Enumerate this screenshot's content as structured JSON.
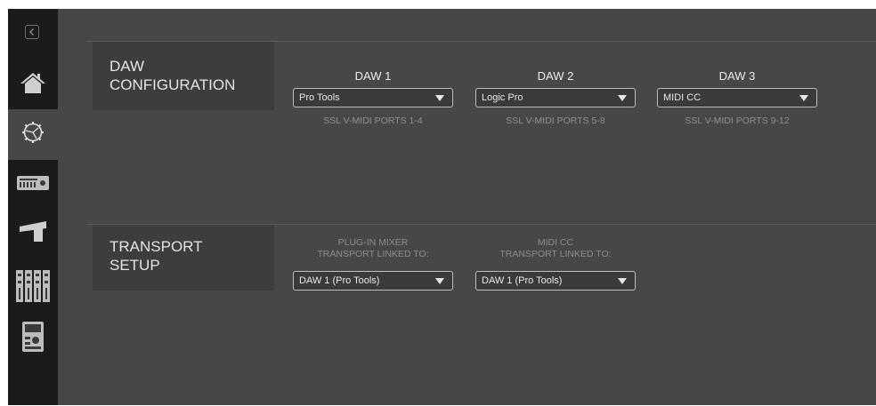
{
  "sidebar": {
    "icons": [
      "collapse-arrow-icon",
      "home-icon",
      "settings-gear-icon",
      "console-module-icon",
      "fader-icon",
      "channel-strips-icon",
      "controller-unit-icon"
    ],
    "active": "settings"
  },
  "daw_config": {
    "title_line1": "DAW",
    "title_line2": "CONFIGURATION",
    "columns": [
      {
        "label": "DAW 1",
        "value": "Pro Tools",
        "ports": "SSL V-MIDI PORTS 1-4"
      },
      {
        "label": "DAW 2",
        "value": "Logic Pro",
        "ports": "SSL V-MIDI PORTS 5-8"
      },
      {
        "label": "DAW 3",
        "value": "MIDI CC",
        "ports": "SSL V-MIDI PORTS 9-12"
      }
    ]
  },
  "transport": {
    "title_line1": "TRANSPORT",
    "title_line2": "SETUP",
    "columns": [
      {
        "label_line1": "PLUG-IN MIXER",
        "label_line2": "TRANSPORT LINKED TO:",
        "value": "DAW 1 (Pro Tools)"
      },
      {
        "label_line1": "MIDI CC",
        "label_line2": "TRANSPORT LINKED TO:",
        "value": "DAW 1 (Pro Tools)"
      }
    ]
  },
  "colors": {
    "sidebar": "#1b1b1b",
    "panel": "#474747",
    "section_header": "#3d3d3d"
  }
}
